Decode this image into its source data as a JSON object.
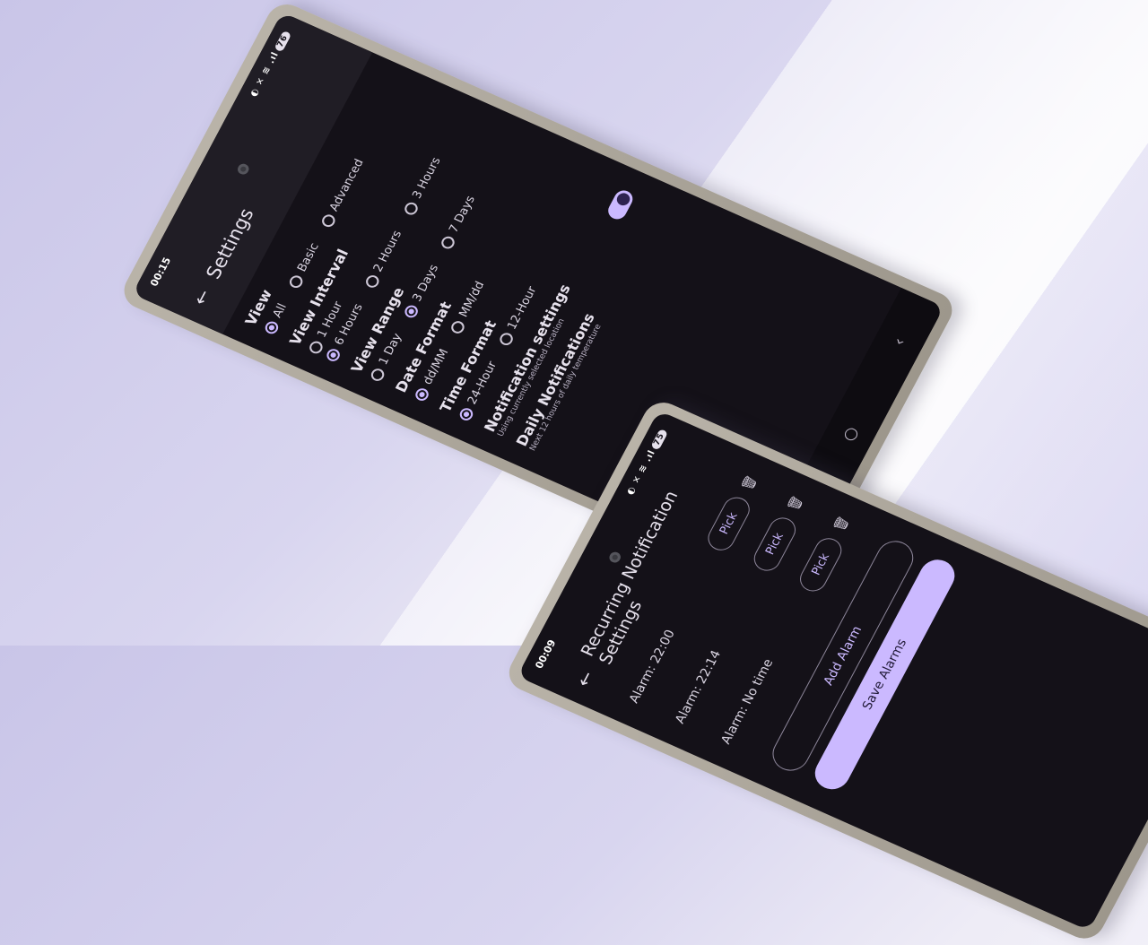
{
  "settings_phone": {
    "status_time": "00:15",
    "status_icons": "◐ ✕ ≋ .ıl",
    "battery": "76",
    "title": "Settings",
    "sections": [
      {
        "title": "View",
        "options": [
          {
            "label": "All",
            "selected": true
          },
          {
            "label": "Basic",
            "selected": false
          },
          {
            "label": "Advanced",
            "selected": false
          }
        ]
      },
      {
        "title": "View Interval",
        "options": [
          {
            "label": "1 Hour",
            "selected": false
          },
          {
            "label": "6 Hours",
            "selected": true
          },
          {
            "label": "2 Hours",
            "selected": false
          },
          {
            "label": "3 Hours",
            "selected": false
          }
        ]
      },
      {
        "title": "View Range",
        "options": [
          {
            "label": "1 Day",
            "selected": false
          },
          {
            "label": "3 Days",
            "selected": true
          },
          {
            "label": "7 Days",
            "selected": false
          }
        ]
      },
      {
        "title": "Date Format",
        "options": [
          {
            "label": "dd/MM",
            "selected": true
          },
          {
            "label": "MM/dd",
            "selected": false
          }
        ]
      },
      {
        "title": "Time Format",
        "options": [
          {
            "label": "24-Hour",
            "selected": true
          },
          {
            "label": "12-Hour",
            "selected": false
          }
        ]
      }
    ],
    "notification_settings": {
      "title": "Notification settings",
      "subtitle": "Using currently selected location"
    },
    "daily_notifications": {
      "title": "Daily Notifications",
      "subtitle": "Next 12 hours of daily temperature",
      "enabled": true
    },
    "nav": {
      "recents": "|||",
      "home": "○",
      "back": "‹"
    }
  },
  "alarms_phone": {
    "status_time": "00:09",
    "status_icons": "◐ ✕ ≋ .ıl",
    "battery": "75",
    "title": "Recurring Notification Settings",
    "alarms": [
      {
        "label": "Alarm: 22:00",
        "button": "Pick"
      },
      {
        "label": "Alarm: 22:14",
        "button": "Pick"
      },
      {
        "label": "Alarm: No time",
        "button": "Pick"
      }
    ],
    "add_label": "Add Alarm",
    "save_label": "Save Alarms"
  },
  "colors": {
    "accent": "#cbb9ff",
    "screen_bg": "#141118",
    "appbar_bg": "#201d25",
    "bezel": "#b1ab9f",
    "background": "#d8d5ef"
  }
}
